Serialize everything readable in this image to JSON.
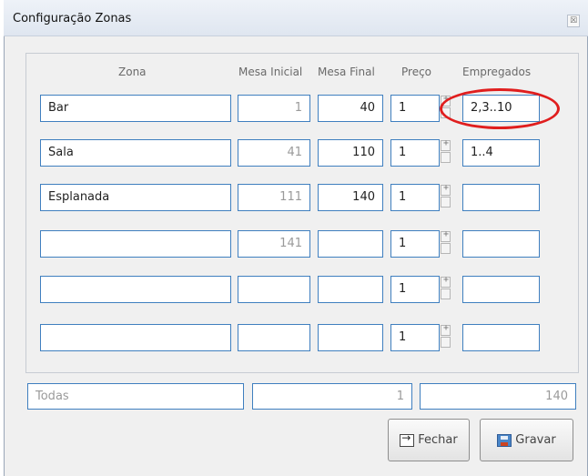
{
  "window": {
    "title": "Configuração Zonas",
    "close_symbol": "☒"
  },
  "headers": {
    "zona": "Zona",
    "mesa_inicial": "Mesa Inicial",
    "mesa_final": "Mesa Final",
    "preco": "Preço",
    "empregados": "Empregados"
  },
  "rows": [
    {
      "zona": "Bar",
      "mesa_inicial": "1",
      "mesa_final": "40",
      "preco": "1",
      "empregados": "2,3..10"
    },
    {
      "zona": "Sala",
      "mesa_inicial": "41",
      "mesa_final": "110",
      "preco": "1",
      "empregados": "1..4"
    },
    {
      "zona": "Esplanada",
      "mesa_inicial": "111",
      "mesa_final": "140",
      "preco": "1",
      "empregados": ""
    },
    {
      "zona": "",
      "mesa_inicial": "141",
      "mesa_final": "",
      "preco": "1",
      "empregados": ""
    },
    {
      "zona": "",
      "mesa_inicial": "",
      "mesa_final": "",
      "preco": "1",
      "empregados": ""
    },
    {
      "zona": "",
      "mesa_inicial": "",
      "mesa_final": "",
      "preco": "1",
      "empregados": ""
    }
  ],
  "totals": {
    "label": "Todas",
    "first": "1",
    "last": "140"
  },
  "buttons": {
    "close_label": "Fechar",
    "save_label": "Gravar"
  },
  "annotation": {
    "color": "#e01e1e"
  }
}
